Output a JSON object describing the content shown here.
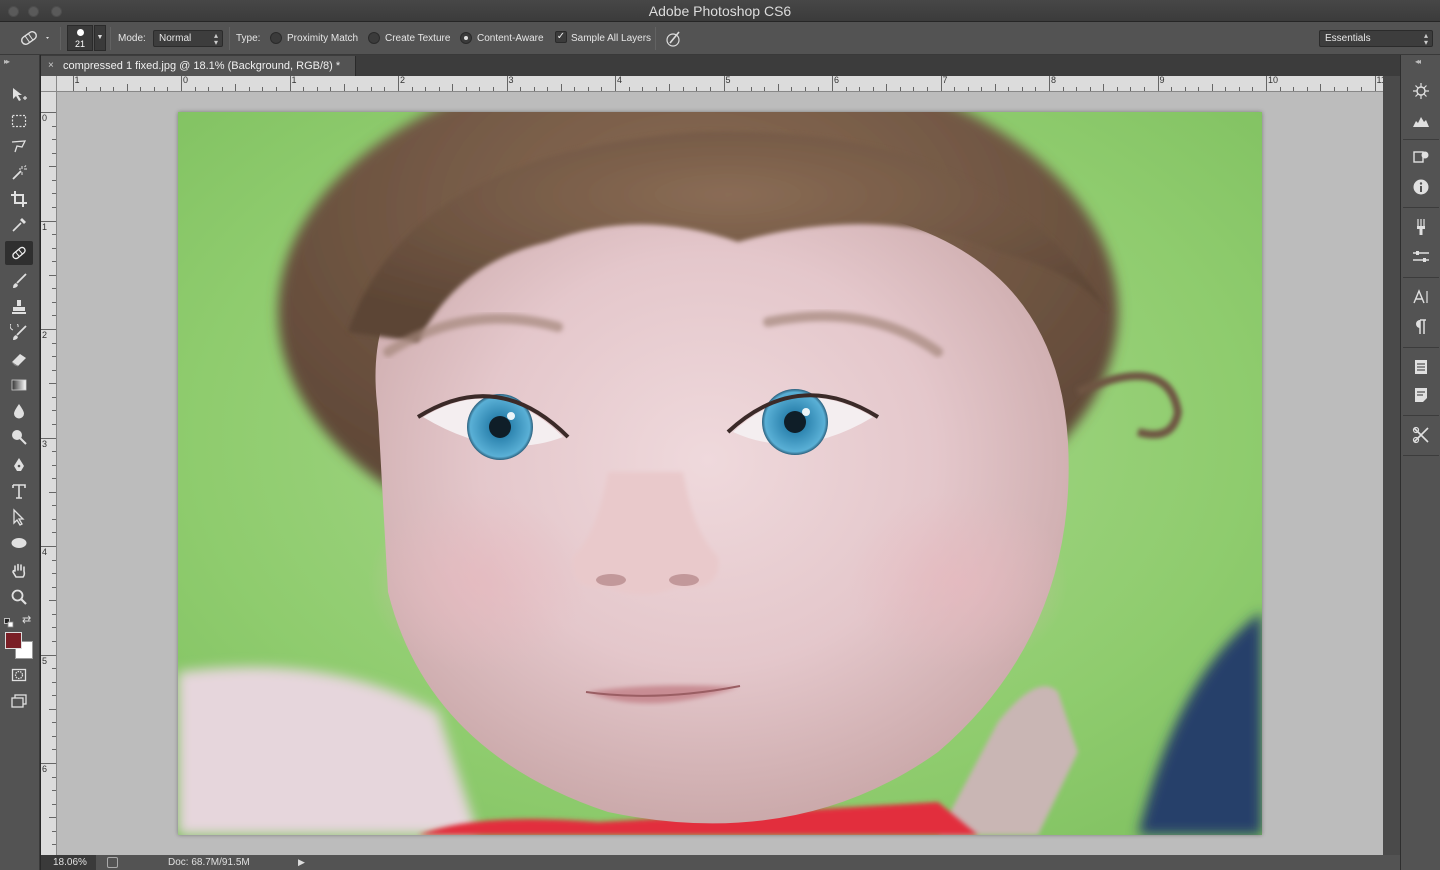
{
  "window": {
    "title": "Adobe Photoshop CS6"
  },
  "options": {
    "brush_size": "21",
    "mode_label": "Mode:",
    "mode_value": "Normal",
    "type_label": "Type:",
    "type_options": [
      "Proximity Match",
      "Create Texture",
      "Content-Aware"
    ],
    "selected_type": "Content-Aware",
    "sample_all_layers": "Sample All Layers",
    "sample_all_layers_checked": true,
    "workspace": "Essentials"
  },
  "document": {
    "tab_title": "compressed 1 fixed.jpg @ 18.1% (Background, RGB/8) *",
    "close_glyph": "×"
  },
  "rulers": {
    "top_labels": [
      "1",
      "0",
      "1",
      "2",
      "3",
      "4",
      "5",
      "6",
      "7",
      "8",
      "9",
      "10",
      "11"
    ],
    "left_labels": [
      "0",
      "1",
      "2",
      "3",
      "4",
      "5",
      "6"
    ]
  },
  "status": {
    "zoom": "18.06%",
    "doc_info": "Doc: 68.7M/91.5M",
    "play_glyph": "▶"
  },
  "tools": [
    "move-tool",
    "marquee-tool",
    "lasso-tool",
    "quick-selection-tool",
    "crop-tool",
    "eyedropper-tool",
    "spot-healing-brush-tool",
    "brush-tool",
    "clone-stamp-tool",
    "history-brush-tool",
    "eraser-tool",
    "gradient-tool",
    "blur-tool",
    "dodge-tool",
    "pen-tool",
    "type-tool",
    "path-selection-tool",
    "ellipse-tool",
    "hand-tool",
    "zoom-tool"
  ],
  "active_tool": "spot-healing-brush-tool",
  "colors": {
    "foreground": "#7a1f26",
    "background": "#ffffff",
    "ui_panel": "#535353",
    "canvas_bg": "#bcbcbc"
  },
  "dock_panels": [
    "color-panel-icon",
    "histogram-icon",
    "adjustments-icon",
    "info-icon",
    "brush-panel-icon",
    "properties-icon",
    "character-icon",
    "paragraph-icon",
    "layers-icon",
    "notes-icon",
    "tool-presets-icon"
  ]
}
